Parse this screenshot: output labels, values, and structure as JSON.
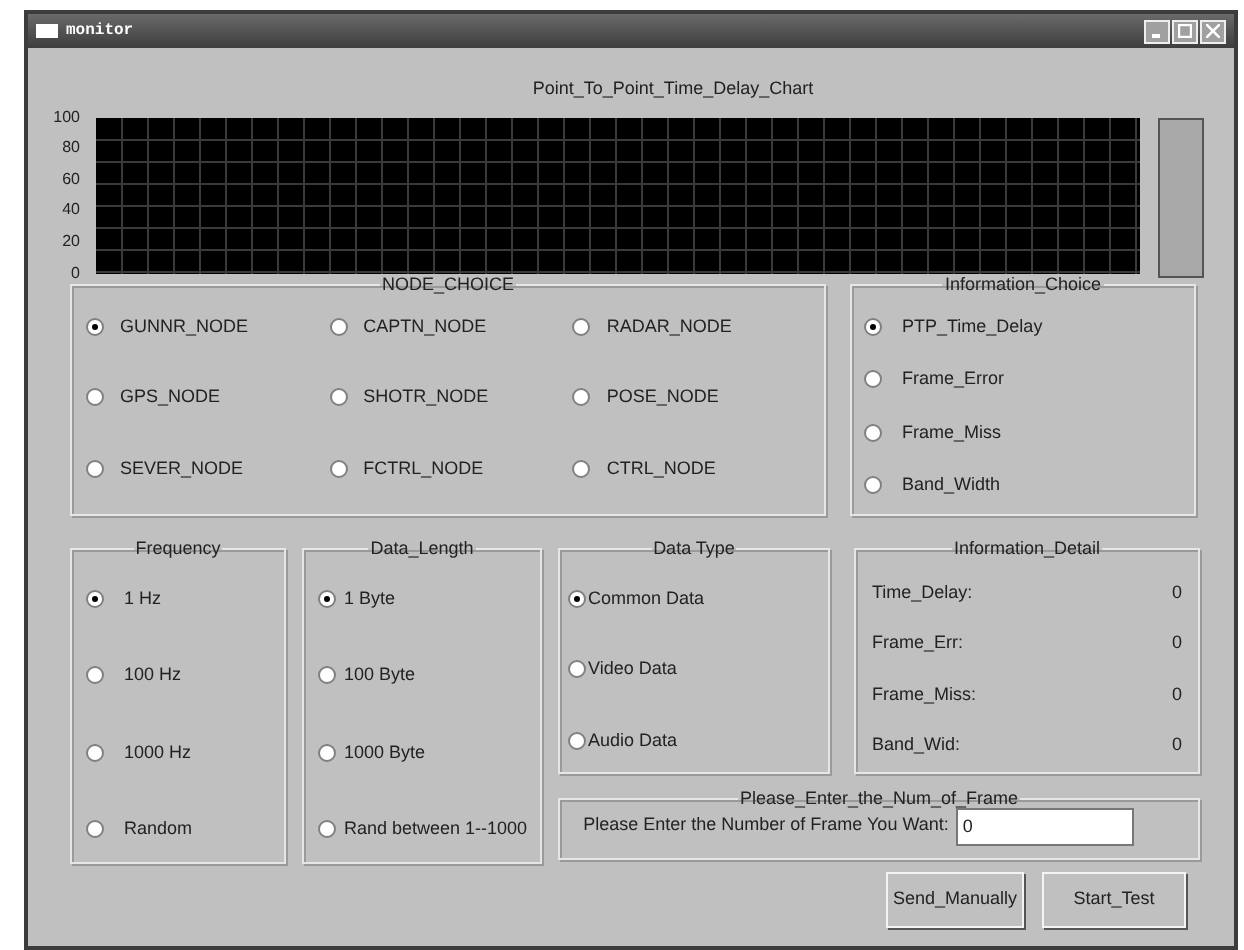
{
  "window": {
    "title": "monitor"
  },
  "chart": {
    "title": "Point_To_Point_Time_Delay_Chart",
    "y_axis_labels": [
      "100",
      "80",
      "60",
      "40",
      "20",
      "0"
    ]
  },
  "node_choice": {
    "title": "NODE_CHOICE",
    "options": [
      {
        "label": "GUNNR_NODE",
        "selected": true
      },
      {
        "label": "CAPTN_NODE",
        "selected": false
      },
      {
        "label": "RADAR_NODE",
        "selected": false
      },
      {
        "label": "GPS_NODE",
        "selected": false
      },
      {
        "label": "SHOTR_NODE",
        "selected": false
      },
      {
        "label": "POSE_NODE",
        "selected": false
      },
      {
        "label": "SEVER_NODE",
        "selected": false
      },
      {
        "label": "FCTRL_NODE",
        "selected": false
      },
      {
        "label": "CTRL_NODE",
        "selected": false
      }
    ]
  },
  "information_choice": {
    "title": "Information_Choice",
    "options": [
      {
        "label": "PTP_Time_Delay",
        "selected": true
      },
      {
        "label": "Frame_Error",
        "selected": false
      },
      {
        "label": "Frame_Miss",
        "selected": false
      },
      {
        "label": "Band_Width",
        "selected": false
      }
    ]
  },
  "frequency": {
    "title": "Frequency",
    "options": [
      {
        "label": "1 Hz",
        "selected": true
      },
      {
        "label": "100 Hz",
        "selected": false
      },
      {
        "label": "1000 Hz",
        "selected": false
      },
      {
        "label": "Random",
        "selected": false
      }
    ]
  },
  "data_length": {
    "title": "Data_Length",
    "options": [
      {
        "label": "1 Byte",
        "selected": true
      },
      {
        "label": "100 Byte",
        "selected": false
      },
      {
        "label": "1000 Byte",
        "selected": false
      },
      {
        "label": "Rand between 1--1000",
        "selected": false
      }
    ]
  },
  "data_type": {
    "title": "Data Type",
    "options": [
      {
        "label": "Common Data",
        "selected": true
      },
      {
        "label": "Video Data",
        "selected": false
      },
      {
        "label": "Audio Data",
        "selected": false
      }
    ]
  },
  "information_detail": {
    "title": "Information_Detail",
    "rows": [
      {
        "label": "Time_Delay:",
        "value": "0"
      },
      {
        "label": "Frame_Err:",
        "value": "0"
      },
      {
        "label": "Frame_Miss:",
        "value": "0"
      },
      {
        "label": "Band_Wid:",
        "value": "0"
      }
    ]
  },
  "frame_entry": {
    "title": "Please_Enter_the_Num_of_Frame",
    "label": "Please Enter the Number of Frame You Want:",
    "value": "0"
  },
  "buttons": [
    "Send_Manually",
    "Start_Test"
  ]
}
